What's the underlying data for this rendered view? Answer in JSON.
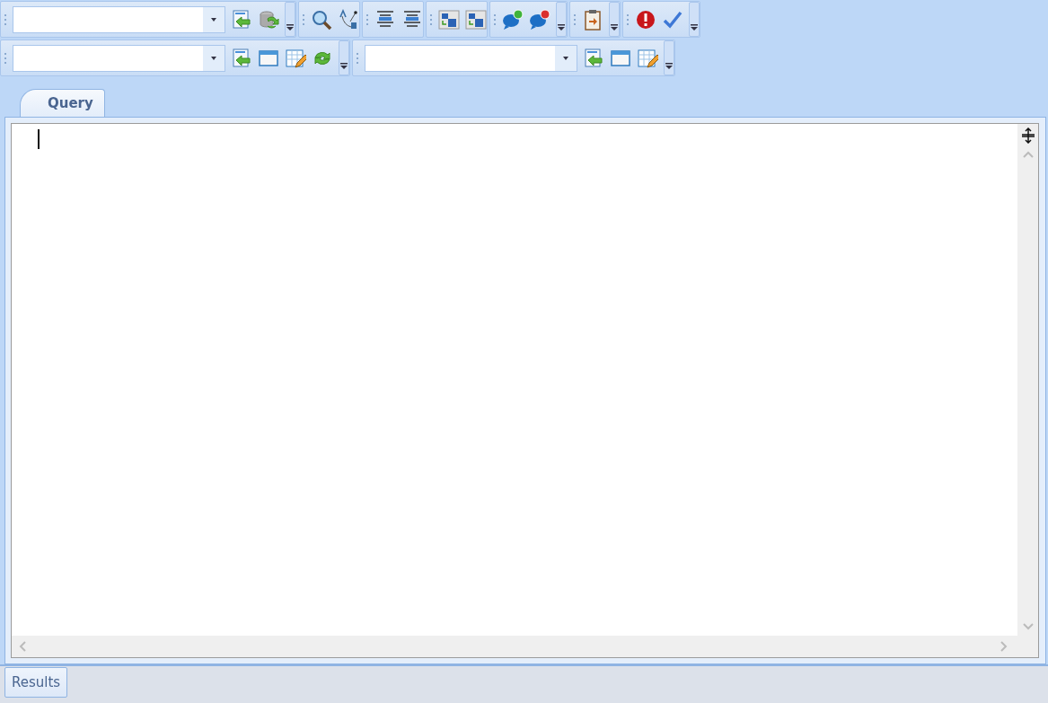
{
  "query_tabs": [
    {
      "label": "Query",
      "selected": true
    }
  ],
  "editor": {
    "focused": true
  },
  "bottom_tabs": [
    {
      "label": "Results",
      "selected": true
    }
  ]
}
